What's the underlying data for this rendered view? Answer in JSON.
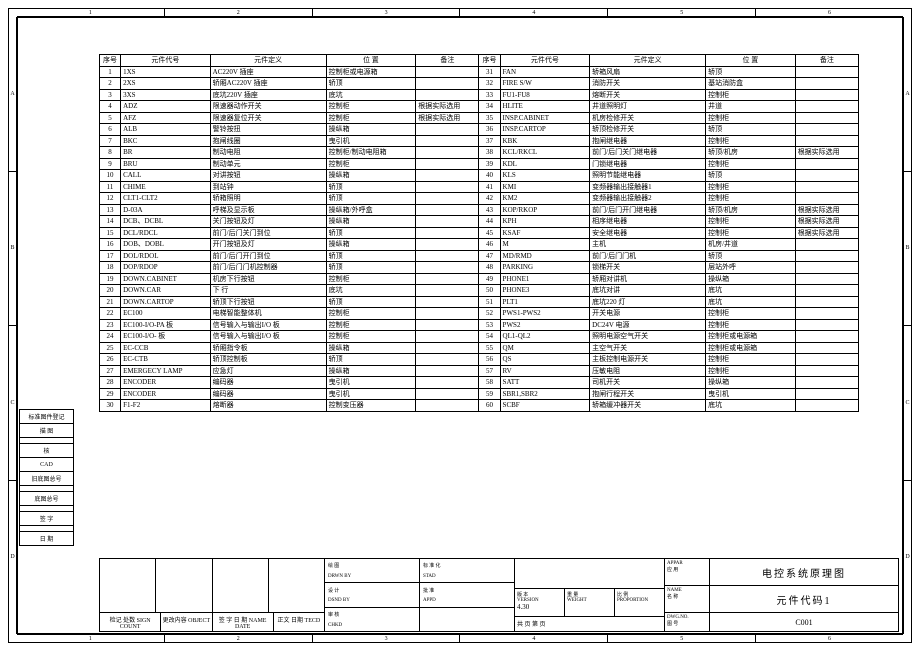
{
  "ruler_cols": [
    "1",
    "2",
    "3",
    "4",
    "5",
    "6"
  ],
  "ruler_rows": [
    "A",
    "B",
    "C",
    "D"
  ],
  "headers": {
    "seq": "序号",
    "code": "元件代号",
    "def": "元件定义",
    "pos": "位 置",
    "note": "备注"
  },
  "rows_left": [
    {
      "n": "1",
      "c": "1XS",
      "d": "AC220V 插座",
      "p": "控制柜或电源箱",
      "r": ""
    },
    {
      "n": "2",
      "c": "2XS",
      "d": "轿厢AC220V 插座",
      "p": "轿顶",
      "r": ""
    },
    {
      "n": "3",
      "c": "3XS",
      "d": "底坑220V 插座",
      "p": "底坑",
      "r": ""
    },
    {
      "n": "4",
      "c": "ADZ",
      "d": "限速器动作开关",
      "p": "控制柜",
      "r": "根据实际选用"
    },
    {
      "n": "5",
      "c": "AFZ",
      "d": "限速器复位开关",
      "p": "控制柜",
      "r": "根据实际选用"
    },
    {
      "n": "6",
      "c": "ALB",
      "d": "警铃按扭",
      "p": "操纵箱",
      "r": ""
    },
    {
      "n": "7",
      "c": "BKC",
      "d": "抱闸线圈",
      "p": "曳引机",
      "r": ""
    },
    {
      "n": "8",
      "c": "BR",
      "d": "制动电阻",
      "p": "控制柜/制动电阻箱",
      "r": ""
    },
    {
      "n": "9",
      "c": "BRU",
      "d": "制动单元",
      "p": "控制柜",
      "r": ""
    },
    {
      "n": "10",
      "c": "CALL",
      "d": "对讲按钮",
      "p": "操纵箱",
      "r": ""
    },
    {
      "n": "11",
      "c": "CHIME",
      "d": "到站钟",
      "p": "轿顶",
      "r": ""
    },
    {
      "n": "12",
      "c": "CLT1-CLT2",
      "d": "轿箱照明",
      "p": "轿顶",
      "r": ""
    },
    {
      "n": "13",
      "c": "D-03A",
      "d": "呼梯及显示板",
      "p": "操纵箱/外呼盒",
      "r": ""
    },
    {
      "n": "14",
      "c": "DCB、DCBL",
      "d": "关门按钮及灯",
      "p": "操纵箱",
      "r": ""
    },
    {
      "n": "15",
      "c": "DCL/RDCL",
      "d": "前门/后门关门到位",
      "p": "轿顶",
      "r": ""
    },
    {
      "n": "16",
      "c": "DOB、DOBL",
      "d": "开门按钮及灯",
      "p": "操纵箱",
      "r": ""
    },
    {
      "n": "17",
      "c": "DOL/RDOL",
      "d": "前门/后门开门到位",
      "p": "轿顶",
      "r": ""
    },
    {
      "n": "18",
      "c": "DOP/RDOP",
      "d": "前门/后门门机控制器",
      "p": "轿顶",
      "r": ""
    },
    {
      "n": "19",
      "c": "DOWN.CABINET",
      "d": "机房下行按钮",
      "p": "控制柜",
      "r": ""
    },
    {
      "n": "20",
      "c": "DOWN.CAR",
      "d": "下 行",
      "p": "底坑",
      "r": ""
    },
    {
      "n": "21",
      "c": "DOWN.CARTOP",
      "d": "轿顶下行按钮",
      "p": "轿顶",
      "r": ""
    },
    {
      "n": "22",
      "c": "EC100",
      "d": "电梯智能整体机",
      "p": "控制柜",
      "r": ""
    },
    {
      "n": "23",
      "c": "EC100-I/O-PA  板",
      "d": "信号输入与输出I/O 板",
      "p": "控制柜",
      "r": ""
    },
    {
      "n": "24",
      "c": "EC100-I/O- 板",
      "d": "信号输入与输出I/O 板",
      "p": "控制柜",
      "r": ""
    },
    {
      "n": "25",
      "c": "EC-CCB",
      "d": "轿厢指令板",
      "p": "操纵箱",
      "r": ""
    },
    {
      "n": "26",
      "c": "EC-CTB",
      "d": "轿顶控制板",
      "p": "轿顶",
      "r": ""
    },
    {
      "n": "27",
      "c": "EMERGECY LAMP",
      "d": "应急灯",
      "p": "操纵箱",
      "r": ""
    },
    {
      "n": "28",
      "c": "ENCODER",
      "d": "编码器",
      "p": "曳引机",
      "r": ""
    },
    {
      "n": "29",
      "c": "ENCODER",
      "d": "编码器",
      "p": "曳引机",
      "r": ""
    },
    {
      "n": "30",
      "c": "F1-F2",
      "d": "熔断器",
      "p": "控制变压器",
      "r": ""
    }
  ],
  "rows_right": [
    {
      "n": "31",
      "c": "FAN",
      "d": "轿箱风扇",
      "p": "轿顶",
      "r": ""
    },
    {
      "n": "32",
      "c": "FIRE S/W",
      "d": "消防开关",
      "p": "基站消防盒",
      "r": ""
    },
    {
      "n": "33",
      "c": "FU1-FU8",
      "d": "熔断开关",
      "p": "控制柜",
      "r": ""
    },
    {
      "n": "34",
      "c": "HLITE",
      "d": "井道照明灯",
      "p": "井道",
      "r": ""
    },
    {
      "n": "35",
      "c": "INSP.CABINET",
      "d": "机房检修开关",
      "p": "控制柜",
      "r": ""
    },
    {
      "n": "36",
      "c": "INSP.CARTOP",
      "d": "轿顶检修开关",
      "p": "轿顶",
      "r": ""
    },
    {
      "n": "37",
      "c": "KBK",
      "d": "抱闸继电器",
      "p": "控制柜",
      "r": ""
    },
    {
      "n": "38",
      "c": "KCL/RKCL",
      "d": "前门/后门关门继电器",
      "p": "轿顶/机房",
      "r": "根据实际选用"
    },
    {
      "n": "39",
      "c": "KDL",
      "d": "门锁继电器",
      "p": "控制柜",
      "r": ""
    },
    {
      "n": "40",
      "c": "KLS",
      "d": "照明节能继电器",
      "p": "轿顶",
      "r": ""
    },
    {
      "n": "41",
      "c": "KMI",
      "d": "变频器输出接触器1",
      "p": "控制柜",
      "r": ""
    },
    {
      "n": "42",
      "c": "KM2",
      "d": "变频器输出接触器2",
      "p": "控制柜",
      "r": ""
    },
    {
      "n": "43",
      "c": "KOP/RKOP",
      "d": "前门/后门开门继电器",
      "p": "轿顶/机房",
      "r": "根据实际选用"
    },
    {
      "n": "44",
      "c": "KPH",
      "d": "相序继电器",
      "p": "控制柜",
      "r": "根据实际选用"
    },
    {
      "n": "45",
      "c": "KSAF",
      "d": "安全继电器",
      "p": "控制柜",
      "r": "根据实际选用"
    },
    {
      "n": "46",
      "c": "M",
      "d": "主机",
      "p": "机房/井道",
      "r": ""
    },
    {
      "n": "47",
      "c": "MD/RMD",
      "d": "前门/后门门机",
      "p": "轿顶",
      "r": ""
    },
    {
      "n": "48",
      "c": "PARKING",
      "d": "锁梯开关",
      "p": "层站外呼",
      "r": ""
    },
    {
      "n": "49",
      "c": "PHONE1",
      "d": "轿厢对讲机",
      "p": "操纵箱",
      "r": ""
    },
    {
      "n": "50",
      "c": "PHONE3",
      "d": "底坑对讲",
      "p": "底坑",
      "r": ""
    },
    {
      "n": "51",
      "c": "PLT1",
      "d": "底坑220 灯",
      "p": "底坑",
      "r": ""
    },
    {
      "n": "52",
      "c": "PWS1-PWS2",
      "d": "开关电源",
      "p": "控制柜",
      "r": ""
    },
    {
      "n": "53",
      "c": "PWS2",
      "d": "DC24V 电源",
      "p": "控制柜",
      "r": ""
    },
    {
      "n": "54",
      "c": "QL1-QL2",
      "d": "照明电源空气开关",
      "p": "控制柜或电源箱",
      "r": ""
    },
    {
      "n": "55",
      "c": "QM",
      "d": "主空气开关",
      "p": "控制柜或电源箱",
      "r": ""
    },
    {
      "n": "56",
      "c": "QS",
      "d": "主板控制电源开关",
      "p": "控制柜",
      "r": ""
    },
    {
      "n": "57",
      "c": "RV",
      "d": "压敏电阻",
      "p": "控制柜",
      "r": ""
    },
    {
      "n": "58",
      "c": "SATT",
      "d": "司机开关",
      "p": "操纵箱",
      "r": ""
    },
    {
      "n": "59",
      "c": "SBR1,SBR2",
      "d": "抱闸行程开关",
      "p": "曳引机",
      "r": ""
    },
    {
      "n": "60",
      "c": "SCBF",
      "d": "轿箱缓冲器开关",
      "p": "底坑",
      "r": ""
    }
  ],
  "side": {
    "row1a": "标准图件登记",
    "row1b": "描 图",
    "row2": "核",
    "row3": "CAD",
    "row4": "旧底图总号",
    "row5": "底图总号",
    "row6": "签 字",
    "row7": "日 期"
  },
  "tb": {
    "sign": "检记 处数 SIGN COUNT",
    "change": "更改内容 OBJECT",
    "sign2": "签 字 日 期 NAME DATE",
    "tecd": "正文 日期 TECD",
    "drwn_l": "绘 图",
    "drwn": "DRWN BY",
    "dsnd_l": "设 计",
    "dsnd": "DSND BY",
    "chkd_l": "审 核",
    "chkd": "CHKD",
    "stad_l": "标 准 化",
    "stad": "STAD",
    "appd_l": "批 准",
    "appd": "APPD",
    "ver_l": "版 本",
    "ver": "VERSION",
    "ver_v": "4.30",
    "weight_l": "重 量",
    "weight": "WEIGHT",
    "prop_l": "比 例",
    "prop": "PROPORTION",
    "sheet": "共  页 第  页",
    "appar_l": "APPAR",
    "appar_cn": "应 用",
    "title": "电控系统原理图",
    "name_l": "NAME",
    "name_cn": "名 称",
    "name_v": "元件代码1",
    "dwg_l": "DWG.NO.",
    "dwg_cn": "图 号",
    "dwg_v": "C001"
  }
}
